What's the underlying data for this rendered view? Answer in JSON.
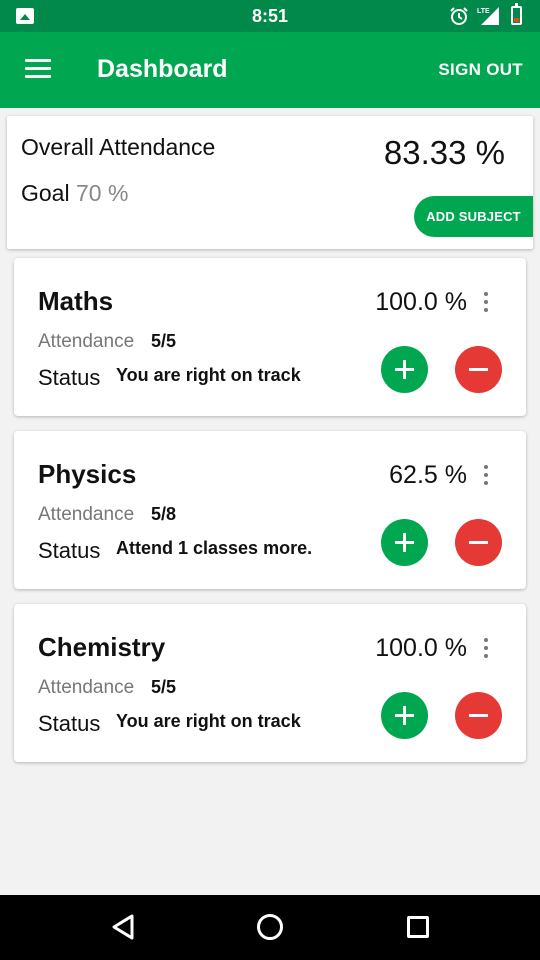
{
  "status_bar": {
    "time": "8:51",
    "network": "LTE",
    "icons": [
      "image-icon",
      "alarm-icon",
      "signal-icon",
      "battery-icon"
    ]
  },
  "app_bar": {
    "title": "Dashboard",
    "sign_out_label": "SIGN OUT",
    "menu_icon": "menu-icon"
  },
  "overall": {
    "title": "Overall Attendance",
    "value": "83.33 %",
    "goal_label": "Goal",
    "goal_value": "70 %",
    "add_subject_label": "ADD SUBJECT"
  },
  "labels": {
    "attendance": "Attendance",
    "status": "Status"
  },
  "subjects": [
    {
      "name": "Maths",
      "percentage": "100.0 %",
      "attendance": "5/5",
      "status": "You are right on track"
    },
    {
      "name": "Physics",
      "percentage": "62.5 %",
      "attendance": "5/8",
      "status": "Attend 1 classes more."
    },
    {
      "name": "Chemistry",
      "percentage": "100.0 %",
      "attendance": "5/5",
      "status": "You are right on track"
    }
  ],
  "colors": {
    "primary": "#00a650",
    "primary_dark": "#00894a",
    "danger": "#e53935",
    "background": "#f2f2f2"
  }
}
